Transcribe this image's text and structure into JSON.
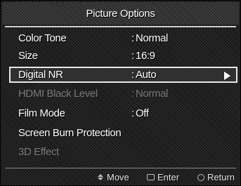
{
  "title": "Picture Options",
  "menu": {
    "items": [
      {
        "label": "Color Tone",
        "colon": ":",
        "value": "Normal"
      },
      {
        "label": "Size",
        "colon": ":",
        "value": "16:9"
      },
      {
        "label": "Digital NR",
        "colon": ":",
        "value": "Auto",
        "selected": true
      },
      {
        "label": "HDMI Black Level",
        "colon": ":",
        "value": "Normal",
        "disabled": true
      },
      {
        "label": "Film Mode",
        "colon": ":",
        "value": "Off"
      },
      {
        "label": "Screen Burn Protection",
        "colon": "",
        "value": ""
      },
      {
        "label": "3D Effect",
        "colon": "",
        "value": "",
        "disabled": true
      }
    ]
  },
  "footer": {
    "move_label": "Move",
    "enter_label": "Enter",
    "return_label": "Return",
    "move_icon": "up-down-arrows-icon",
    "enter_icon": "enter-icon",
    "return_icon": "return-icon"
  },
  "colors": {
    "background": "#1c1c1c",
    "text": "#ffffff",
    "disabled_text": "#7a7a7a",
    "highlight_border": "#e8e8e8"
  }
}
